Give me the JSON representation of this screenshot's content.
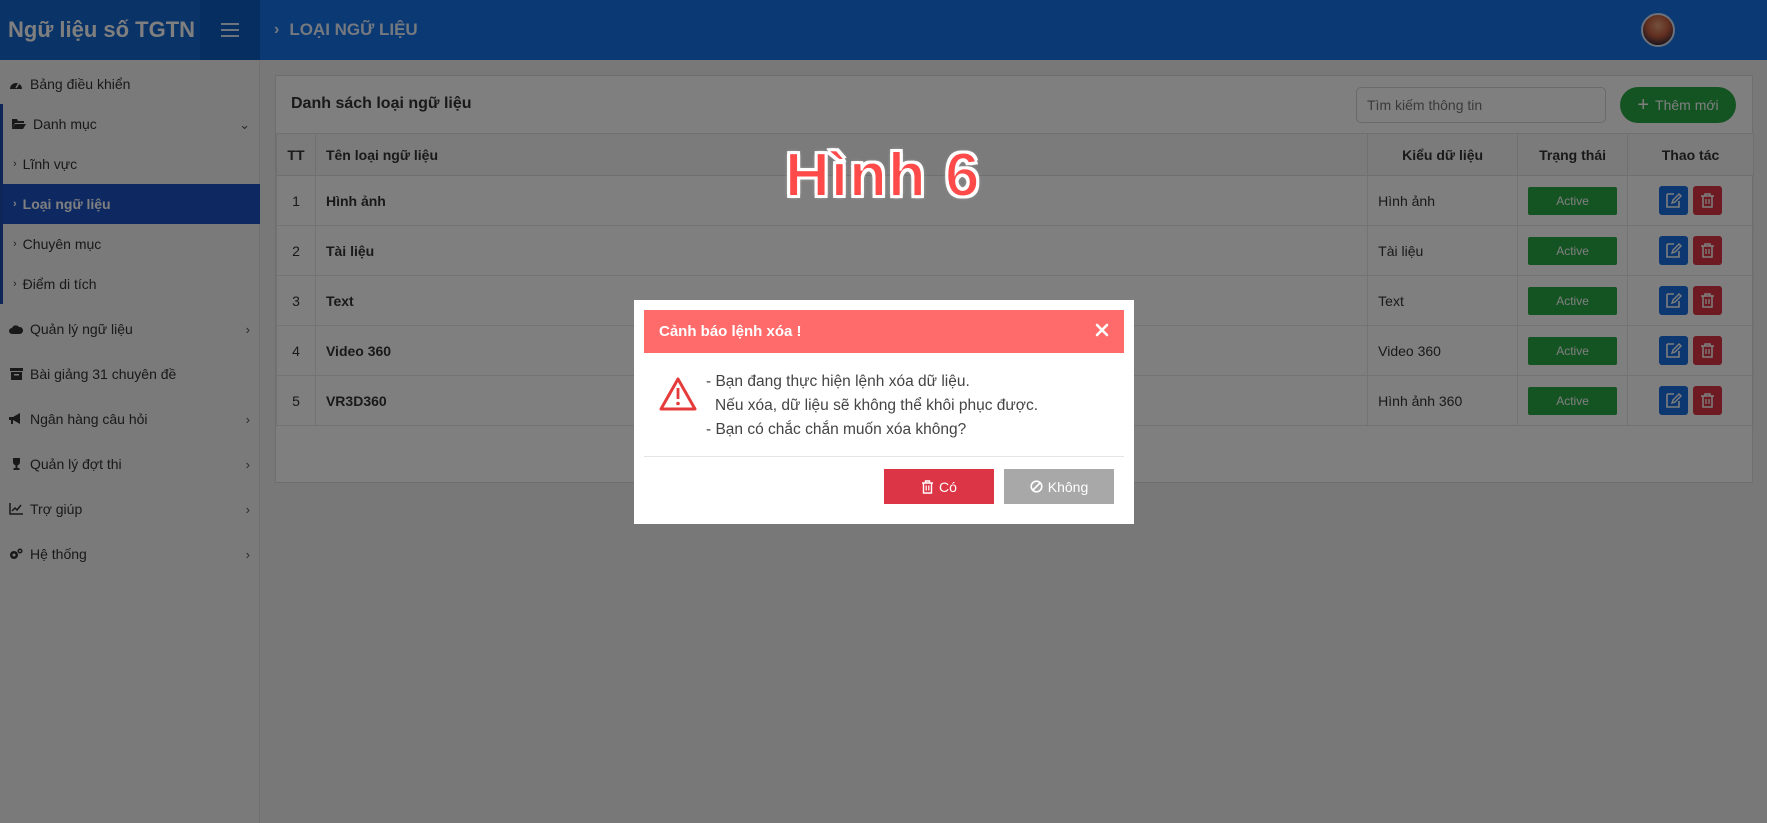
{
  "app": {
    "title": "Ngữ liệu số TGTN"
  },
  "breadcrumb": {
    "current": "LOẠI NGỮ LIỆU"
  },
  "sidebar": {
    "items": [
      {
        "label": "Bảng điều khiển",
        "icon": "dashboard-icon"
      },
      {
        "label": "Danh mục",
        "icon": "folder-open-icon"
      },
      {
        "label": "Lĩnh vực"
      },
      {
        "label": "Loại ngữ liệu"
      },
      {
        "label": "Chuyên mục"
      },
      {
        "label": "Điểm di tích"
      },
      {
        "label": "Quản lý ngữ liệu",
        "icon": "cloud-icon"
      },
      {
        "label": "Bài giảng 31 chuyên đề",
        "icon": "archive-icon"
      },
      {
        "label": "Ngân hàng câu hỏi",
        "icon": "bullhorn-icon"
      },
      {
        "label": "Quản lý đợt thi",
        "icon": "trophy-icon"
      },
      {
        "label": "Trợ giúp",
        "icon": "line-chart-icon"
      },
      {
        "label": "Hệ thống",
        "icon": "cogs-icon"
      }
    ]
  },
  "main": {
    "title": "Danh sách loại ngữ liệu",
    "search_placeholder": "Tìm kiếm thông tin",
    "add_label": "Thêm mới",
    "columns": [
      "TT",
      "Tên loại ngữ liệu",
      "Kiểu dữ liệu",
      "Trạng thái",
      "Thao tác"
    ],
    "rows": [
      {
        "tt": "1",
        "name": "Hình ảnh",
        "type": "Hình ảnh",
        "status": "Active"
      },
      {
        "tt": "2",
        "name": "Tài liệu",
        "type": "Tài liệu",
        "status": "Active"
      },
      {
        "tt": "3",
        "name": "Text",
        "type": "Text",
        "status": "Active"
      },
      {
        "tt": "4",
        "name": "Video 360",
        "type": "Video 360",
        "status": "Active"
      },
      {
        "tt": "5",
        "name": "VR3D360",
        "type": "Hình ảnh 360",
        "status": "Active"
      }
    ]
  },
  "watermark": "Hình 6",
  "dialog": {
    "title": "Cảnh báo lệnh xóa !",
    "line1": "- Bạn đang thực hiện lệnh xóa dữ liệu.",
    "line2": "Nếu xóa, dữ liệu sẽ không thể khôi phục được.",
    "line3": "- Bạn có chắc chắn muốn xóa không?",
    "yes_label": "Có",
    "no_label": "Không"
  },
  "colors": {
    "header": "#1473e6",
    "active_sidebar": "#1c53c3",
    "success": "#28a745",
    "danger": "#dc3545",
    "dialog_header": "#ff6b6b"
  }
}
